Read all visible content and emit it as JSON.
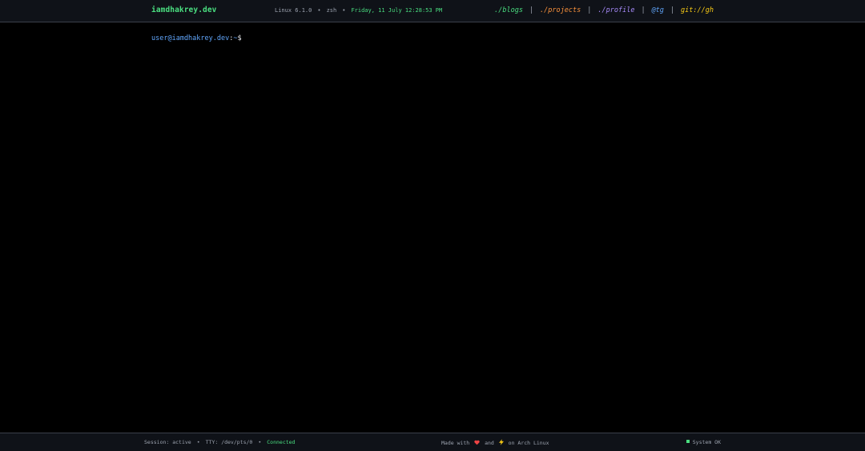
{
  "header": {
    "brand": "iamdhakrey.dev",
    "kernel": "Linux 6.1.0",
    "shell": "zsh",
    "datetime": "Friday, 11 July 12:28:53 PM",
    "separator": "•",
    "nav": [
      {
        "label": "./blogs",
        "color": "#4ade80"
      },
      {
        "label": "./projects",
        "color": "#fb923c"
      },
      {
        "label": "./profile",
        "color": "#a78bfa"
      },
      {
        "label": "@tg",
        "color": "#60a5fa"
      },
      {
        "label": "git://gh",
        "color": "#facc15"
      }
    ],
    "nav_divider": "|"
  },
  "terminal": {
    "user_host": "user@iamdhakrey.dev",
    "colon": ":",
    "path": "~",
    "symbol": "$",
    "input_value": ""
  },
  "footer": {
    "session": "Session: active",
    "tty": "TTY: /dev/pts/0",
    "connection": "Connected",
    "separator": "•",
    "made_with": "Made with",
    "heart_icon": "heart-icon",
    "and": "and",
    "bolt_icon": "bolt-icon",
    "on_os": "on Arch Linux",
    "status": "System OK"
  },
  "colors": {
    "background": "#000000",
    "bar_background": "#0f1218",
    "accent_green": "#4ade80",
    "accent_blue": "#60a5fa",
    "muted": "#9ca3af"
  }
}
